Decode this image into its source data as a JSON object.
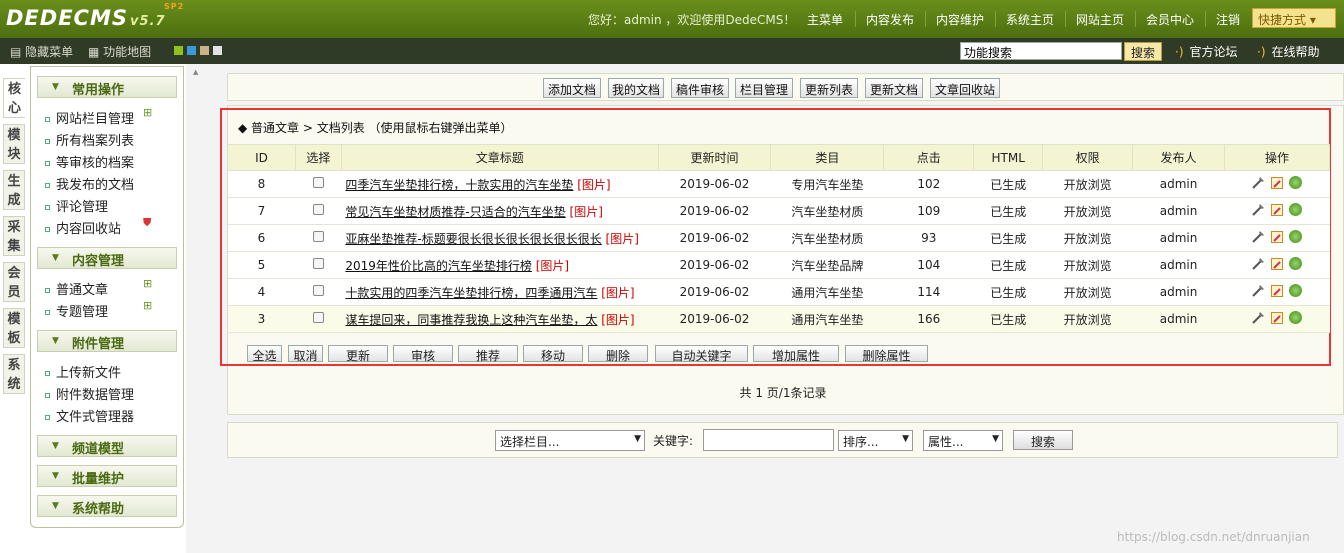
{
  "header": {
    "logo": "DEDECMS",
    "version": "v5.7",
    "version_sup": "SP2",
    "greeting": "您好：admin ，欢迎使用DedeCMS！",
    "nav": [
      "主菜单",
      "内容发布",
      "内容维护",
      "系统主页",
      "网站主页",
      "会员中心",
      "注销"
    ],
    "quick": "快捷方式 ▾"
  },
  "subbar": {
    "hide_menu": "隐藏菜单",
    "site_map": "功能地图",
    "swatches": [
      "#8fc21f",
      "#3a9ad9",
      "#c9b489",
      "#e3e3e3"
    ],
    "search_value": "功能搜索",
    "search_button": "搜索",
    "forum": "官方论坛",
    "help": "在线帮助"
  },
  "vtabs": [
    "核心",
    "模块",
    "生成",
    "采集",
    "会员",
    "模板",
    "系统"
  ],
  "sidebar": {
    "groups": [
      {
        "title": "常用操作",
        "items": [
          "网站栏目管理",
          "所有档案列表",
          "等审核的档案",
          "我发布的文档",
          "评论管理",
          "内容回收站"
        ]
      },
      {
        "title": "内容管理",
        "items": [
          "普通文章",
          "专题管理"
        ]
      },
      {
        "title": "附件管理",
        "items": [
          "上传新文件",
          "附件数据管理",
          "文件式管理器"
        ]
      },
      {
        "title": "频道模型",
        "items": []
      },
      {
        "title": "批量维护",
        "items": []
      },
      {
        "title": "系统帮助",
        "items": []
      }
    ]
  },
  "toolbar": [
    "添加文档",
    "我的文档",
    "稿件审核",
    "栏目管理",
    "更新列表",
    "更新文档",
    "文章回收站"
  ],
  "breadcrumb": "◆ 普通文章 > 文档列表  （使用鼠标右键弹出菜单）",
  "columns": [
    "ID",
    "选择",
    "文章标题",
    "更新时间",
    "类目",
    "点击",
    "HTML",
    "权限",
    "发布人",
    "操作"
  ],
  "rows": [
    {
      "id": "8",
      "title": "四季汽车坐垫排行榜，十款实用的汽车坐垫",
      "pic": "[图片]",
      "date": "2019-06-02",
      "cat": "专用汽车坐垫",
      "hits": "102",
      "html": "已生成",
      "perm": "开放浏览",
      "author": "admin"
    },
    {
      "id": "7",
      "title": "常见汽车坐垫材质推荐-只适合的汽车坐垫",
      "pic": "[图片]",
      "date": "2019-06-02",
      "cat": "汽车坐垫材质",
      "hits": "109",
      "html": "已生成",
      "perm": "开放浏览",
      "author": "admin"
    },
    {
      "id": "6",
      "title": "亚麻坐垫推荐-标题要很长很长很长很长很长很长",
      "pic": "[图片]",
      "date": "2019-06-02",
      "cat": "汽车坐垫材质",
      "hits": "93",
      "html": "已生成",
      "perm": "开放浏览",
      "author": "admin"
    },
    {
      "id": "5",
      "title": "2019年性价比高的汽车坐垫排行榜",
      "pic": "[图片]",
      "date": "2019-06-02",
      "cat": "汽车坐垫品牌",
      "hits": "104",
      "html": "已生成",
      "perm": "开放浏览",
      "author": "admin"
    },
    {
      "id": "4",
      "title": "十款实用的四季汽车坐垫排行榜，四季通用汽车",
      "pic": "[图片]",
      "date": "2019-06-02",
      "cat": "通用汽车坐垫",
      "hits": "114",
      "html": "已生成",
      "perm": "开放浏览",
      "author": "admin"
    },
    {
      "id": "3",
      "title": "谋车提回来，同事推荐我换上这种汽车坐垫，太",
      "pic": "[图片]",
      "date": "2019-06-02",
      "cat": "通用汽车坐垫",
      "hits": "166",
      "html": "已生成",
      "perm": "开放浏览",
      "author": "admin"
    }
  ],
  "bulk_buttons": [
    "全选",
    "取消",
    "更新",
    "审核",
    "推荐",
    "移动",
    "删除",
    "自动关键字",
    "增加属性",
    "删除属性"
  ],
  "pager": "共 1 页/1条记录",
  "search": {
    "category": "选择栏目...",
    "keyword_label": "关键字:",
    "keyword_value": "",
    "sort": "排序...",
    "attr": "属性...",
    "button": "搜索"
  },
  "watermark": "https://blog.csdn.net/dnruanjian"
}
